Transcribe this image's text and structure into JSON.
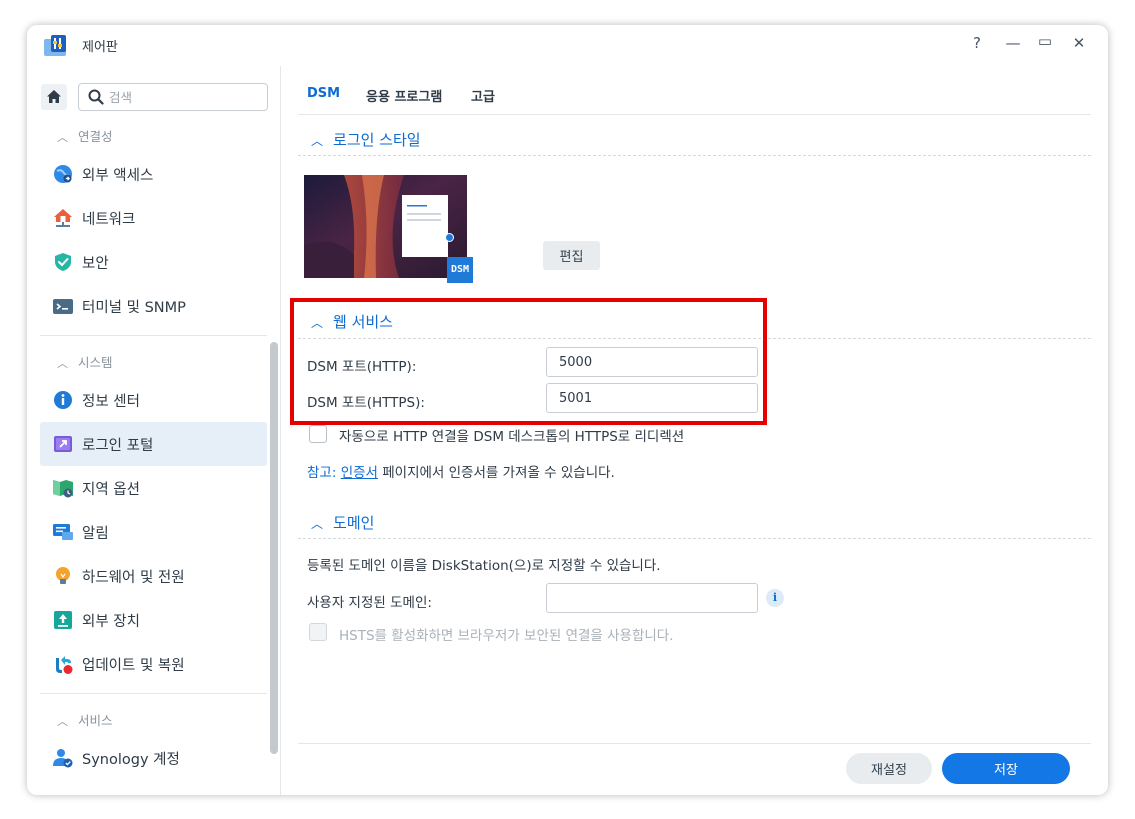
{
  "window": {
    "title": "제어판",
    "controls": {
      "help": "?",
      "minimize": "—",
      "maximize": "▭",
      "close": "✕"
    }
  },
  "sidebar": {
    "search_placeholder": "검색",
    "sections": [
      {
        "label": "연결성"
      },
      {
        "label": "시스템"
      },
      {
        "label": "서비스"
      }
    ],
    "items": [
      {
        "label": "외부 액세스",
        "icon": "globe-icon",
        "color": "#2e8ae6"
      },
      {
        "label": "네트워크",
        "icon": "house-network-icon",
        "color": "#e8603c"
      },
      {
        "label": "보안",
        "icon": "shield-icon",
        "color": "#27b5a5"
      },
      {
        "label": "터미널 및 SNMP",
        "icon": "terminal-icon",
        "color": "#4a6b86"
      },
      {
        "label": "정보 센터",
        "icon": "info-icon",
        "color": "#1f7ad8"
      },
      {
        "label": "로그인 포털",
        "icon": "login-portal-icon",
        "color": "#7b5ad6",
        "active": true
      },
      {
        "label": "지역 옵션",
        "icon": "map-clock-icon",
        "color": "#2ba66d"
      },
      {
        "label": "알림",
        "icon": "chat-icon",
        "color": "#1f7ad8"
      },
      {
        "label": "하드웨어 및 전원",
        "icon": "bulb-icon",
        "color": "#f4a32c"
      },
      {
        "label": "외부 장치",
        "icon": "upload-device-icon",
        "color": "#17a69a"
      },
      {
        "label": "업데이트 및 복원",
        "icon": "update-icon",
        "color": "#1b7cc8"
      },
      {
        "label": "Synology 계정",
        "icon": "user-account-icon",
        "color": "#2e8ae6"
      }
    ]
  },
  "tabs": [
    {
      "label": "DSM",
      "active": true
    },
    {
      "label": "응용 프로그램"
    },
    {
      "label": "고급"
    }
  ],
  "login_style": {
    "title": "로그인 스타일",
    "edit_label": "편집",
    "badge": "DSM"
  },
  "web_service": {
    "title": "웹 서비스",
    "http_label": "DSM 포트(HTTP):",
    "http_value": "5000",
    "https_label": "DSM 포트(HTTPS):",
    "https_value": "5001",
    "redirect_label": "자동으로 HTTP 연결을 DSM 데스크톱의 HTTPS로 리디렉션",
    "note_prefix": "참고:",
    "note_link": "인증서",
    "note_suffix": "페이지에서 인증서를 가져올 수 있습니다."
  },
  "domain": {
    "title": "도메인",
    "description": "등록된 도메인 이름을 DiskStation(으)로 지정할 수 있습니다.",
    "custom_label": "사용자 지정된 도메인:",
    "custom_value": "",
    "hsts_label": "HSTS를 활성화하면 브라우저가 보안된 연결을 사용합니다."
  },
  "footer": {
    "reset_label": "재설정",
    "save_label": "저장"
  },
  "colors": {
    "accent": "#0e6bd2",
    "primary_button": "#1477e6",
    "highlight": "#e60000"
  }
}
